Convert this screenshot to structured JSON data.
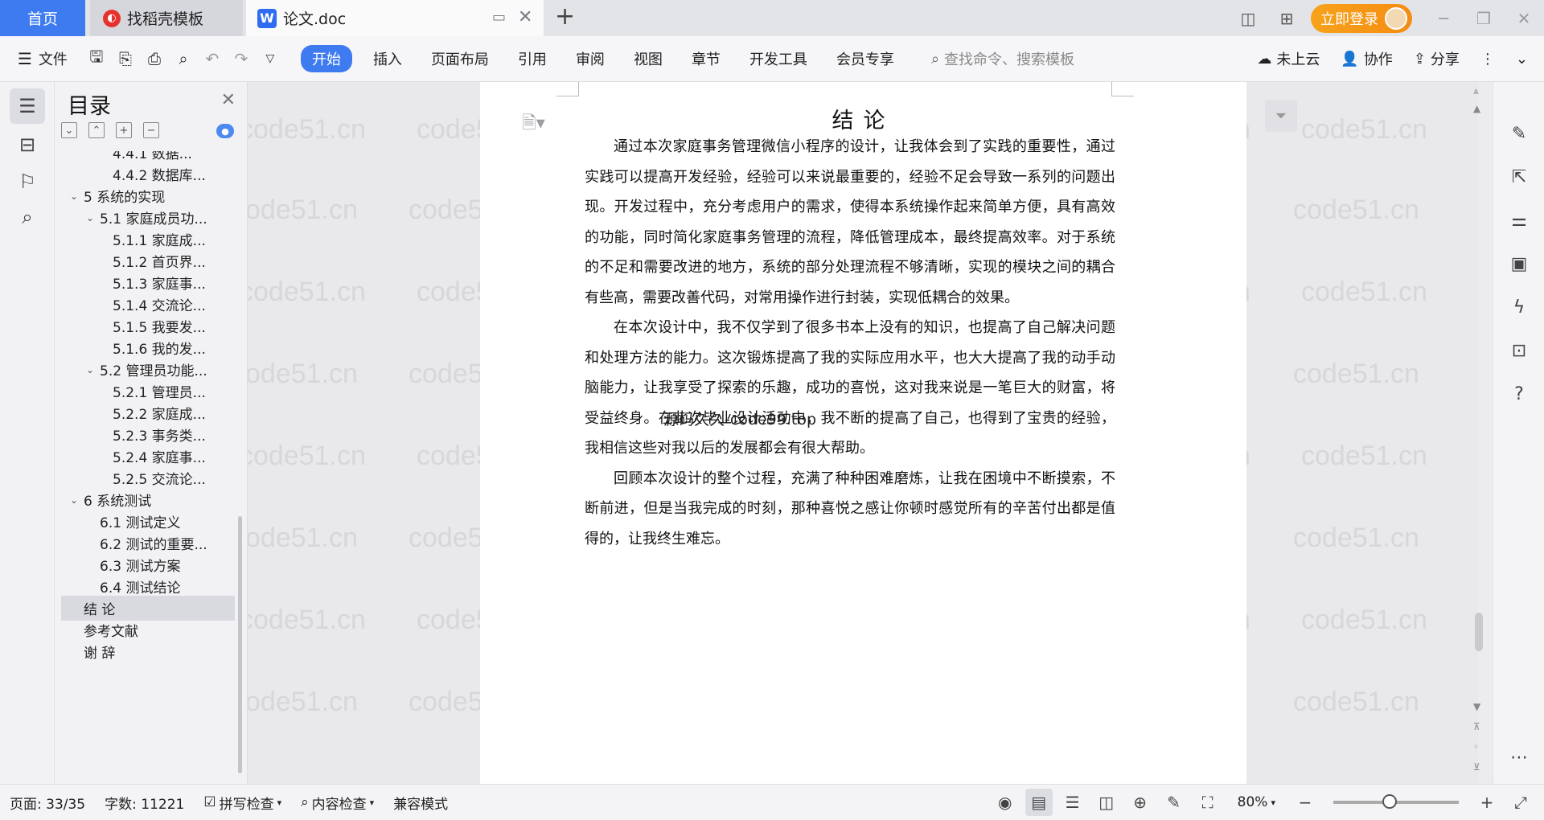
{
  "tabs": {
    "home": "首页",
    "template": "找稻壳模板",
    "doc": "论文.doc"
  },
  "titlebar": {
    "login": "立即登录"
  },
  "menu": {
    "file": "文件",
    "items": [
      "开始",
      "插入",
      "页面布局",
      "引用",
      "审阅",
      "视图",
      "章节",
      "开发工具",
      "会员专享"
    ],
    "search_placeholder": "查找命令、搜索模板",
    "cloud": "未上云",
    "collab": "协作",
    "share": "分享"
  },
  "outline": {
    "title": "目录",
    "items": [
      {
        "label": "4.4.1 数据...",
        "level": 3
      },
      {
        "label": "4.4.2 数据库...",
        "level": 3
      },
      {
        "label": "5  系统的实现",
        "level": 1,
        "expanded": true
      },
      {
        "label": "5.1 家庭成员功...",
        "level": 2,
        "expanded": true
      },
      {
        "label": "5.1.1 家庭成...",
        "level": 3
      },
      {
        "label": "5.1.2 首页界...",
        "level": 3
      },
      {
        "label": "5.1.3 家庭事...",
        "level": 3
      },
      {
        "label": "5.1.4 交流论...",
        "level": 3
      },
      {
        "label": "5.1.5 我要发...",
        "level": 3
      },
      {
        "label": "5.1.6 我的发...",
        "level": 3
      },
      {
        "label": "5.2 管理员功能...",
        "level": 2,
        "expanded": true
      },
      {
        "label": "5.2.1 管理员...",
        "level": 3
      },
      {
        "label": "5.2.2 家庭成...",
        "level": 3
      },
      {
        "label": "5.2.3 事务类...",
        "level": 3
      },
      {
        "label": "5.2.4 家庭事...",
        "level": 3
      },
      {
        "label": "5.2.5 交流论...",
        "level": 3
      },
      {
        "label": "6 系统测试",
        "level": 1,
        "expanded": true
      },
      {
        "label": "6.1 测试定义",
        "level": 2
      },
      {
        "label": "6.2 测试的重要...",
        "level": 2
      },
      {
        "label": "6.3 测试方案",
        "level": 2
      },
      {
        "label": "6.4 测试结论",
        "level": 2
      },
      {
        "label": "结  论",
        "level": 1,
        "selected": true
      },
      {
        "label": "参考文献",
        "level": 1
      },
      {
        "label": "谢  辞",
        "level": 1
      }
    ]
  },
  "document": {
    "heading": "结论",
    "paragraphs": [
      "通过本次家庭事务管理微信小程序的设计，让我体会到了实践的重要性，通过实践可以提高开发经验，经验可以来说最重要的，经验不足会导致一系列的问题出现。开发过程中，充分考虑用户的需求，使得本系统操作起来简单方便，具有高效的功能，同时简化家庭事务管理的流程，降低管理成本，最终提高效率。对于系统的不足和需要改进的地方，系统的部分处理流程不够清晰，实现的模块之间的耦合有些高，需要改善代码，对常用操作进行封装，实现低耦合的效果。",
      "在本次设计中，我不仅学到了很多书本上没有的知识，也提高了自己解决问题和处理方法的能力。这次锻炼提高了我的实际应用水平，也大大提高了我的动手动脑能力，让我享受了探索的乐趣，成功的喜悦，这对我来说是一笔巨大的财富，将受益终身。在此次毕业设计活动中，我不断的提高了自己，也得到了宝贵的经验，我相信这些对我以后的发展都会有很大帮助。",
      "回顾本次设计的整个过程，充满了种种困难磨炼，让我在困境中不断摸索，不断前进，但是当我完成的时刻，那种喜悦之感让你顿时感觉所有的辛苦付出都是值得的，让我终生难忘。"
    ],
    "source_watermark": "源码久久-code99.top",
    "watermark": "code51.cn"
  },
  "status": {
    "page": "页面: 33/35",
    "words": "字数: 11221",
    "spell": "拼写检查",
    "content_check": "内容检查",
    "compat": "兼容模式",
    "zoom": "80%",
    "zoom_level": 0.45
  },
  "colors": {
    "accent": "#3f7bf0",
    "login": "#f5961a"
  }
}
